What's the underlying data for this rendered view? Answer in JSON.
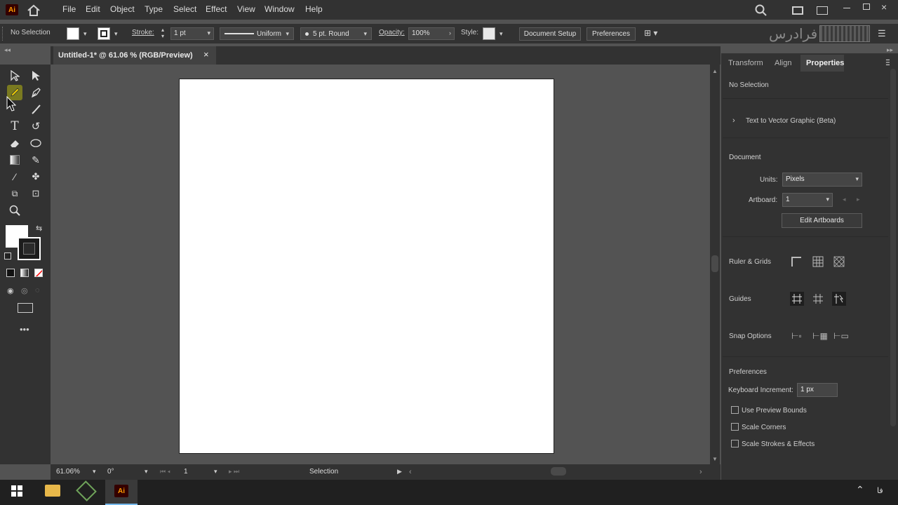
{
  "app": {
    "logo": "Ai"
  },
  "menu": {
    "items": [
      "File",
      "Edit",
      "Object",
      "Type",
      "Select",
      "Effect",
      "View",
      "Window",
      "Help"
    ]
  },
  "control_bar": {
    "selection": "No Selection",
    "stroke_label": "Stroke:",
    "stroke_weight": "1 pt",
    "stroke_profile": "Uniform",
    "brush": "5 pt. Round",
    "opacity_label": "Opacity:",
    "opacity_value": "100%",
    "style_label": "Style:",
    "doc_setup": "Document Setup",
    "preferences": "Preferences"
  },
  "watermark": "فرادرس",
  "document_tab": {
    "title": "Untitled-1* @ 61.06 % (RGB/Preview)"
  },
  "status_bar": {
    "zoom": "61.06%",
    "rotation": "0°",
    "artboard": "1",
    "tool": "Selection"
  },
  "right_panel": {
    "tabs": [
      "Transform",
      "Align",
      "Properties"
    ],
    "active_tab": "Properties",
    "selection_status": "No Selection",
    "text_to_vector": "Text to Vector Graphic (Beta)",
    "document_heading": "Document",
    "units_label": "Units:",
    "units_value": "Pixels",
    "artboard_label": "Artboard:",
    "artboard_value": "1",
    "edit_artboards": "Edit Artboards",
    "ruler_grids": "Ruler & Grids",
    "guides": "Guides",
    "snap_options": "Snap Options",
    "preferences_heading": "Preferences",
    "keyboard_increment_label": "Keyboard Increment:",
    "keyboard_increment_value": "1 px",
    "checkboxes": [
      "Use Preview Bounds",
      "Scale Corners",
      "Scale Strokes & Effects"
    ]
  },
  "taskbar": {
    "language": "فا",
    "ai_label": "Ai"
  },
  "colors": {
    "accent": "#ff9a00",
    "chrome": "#323232",
    "canvas": "#535353",
    "artboard": "#ffffff"
  }
}
